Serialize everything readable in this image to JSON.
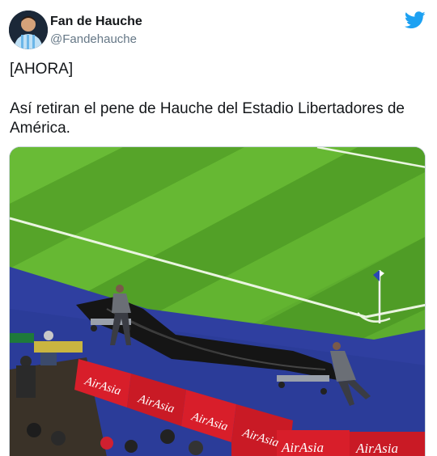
{
  "tweet": {
    "author_name": "Fan de Hauche",
    "author_handle": "@Fandehauche",
    "line1": "[AHORA]",
    "line2": "Así retiran el pene de Hauche del Estadio Libertadores de América.",
    "twitter_brand_color": "#1da1f2",
    "icons": {
      "platform": "twitter-bird-icon"
    }
  },
  "media": {
    "boards": [
      "AirAsia",
      "AirAsia",
      "AirAsia",
      "AirAsia",
      "AirAsia",
      "AirAsia"
    ]
  }
}
